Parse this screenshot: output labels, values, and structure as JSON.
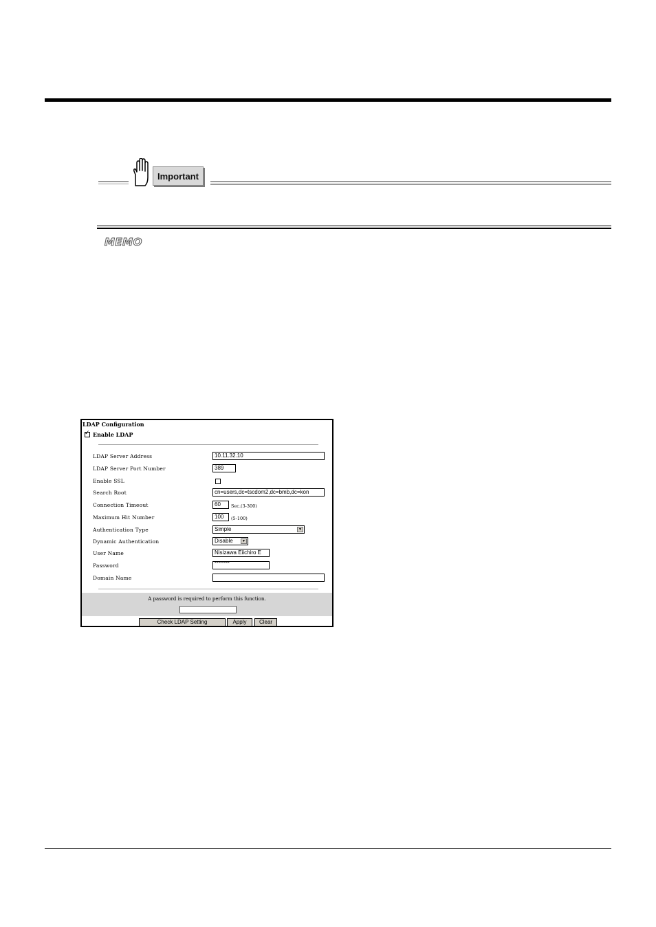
{
  "banners": {
    "important_label": "Important",
    "memo_label": "MEMO"
  },
  "ldap": {
    "title": "LDAP Configuration",
    "enable_ldap": {
      "label": "Enable LDAP",
      "checked": true
    },
    "fields": {
      "server_address": {
        "label": "LDAP Server Address",
        "value": "10.11.32.10"
      },
      "port": {
        "label": "LDAP Server Port Number",
        "value": "389"
      },
      "enable_ssl": {
        "label": "Enable SSL",
        "checked": false
      },
      "search_root": {
        "label": "Search Root",
        "value": "cn=users,dc=tscdom2,dc=bmb,dc=kon"
      },
      "timeout": {
        "label": "Connection Timeout",
        "value": "60",
        "hint": "Sec.(3-300)"
      },
      "max_hit": {
        "label": "Maximum Hit Number",
        "value": "100",
        "hint": "(5-100)"
      },
      "auth_type": {
        "label": "Authentication Type",
        "value": "Simple"
      },
      "dynamic_auth": {
        "label": "Dynamic Authentication",
        "value": "Disable"
      },
      "user_name": {
        "label": "User Name",
        "value": "Nisizawa Eiichiro E"
      },
      "password": {
        "label": "Password",
        "value": "********"
      },
      "domain_name": {
        "label": "Domain Name",
        "value": ""
      }
    },
    "password_note": "A password is required to perform this function.",
    "buttons": {
      "check": "Check LDAP Setting",
      "apply": "Apply",
      "clear": "Clear"
    }
  }
}
